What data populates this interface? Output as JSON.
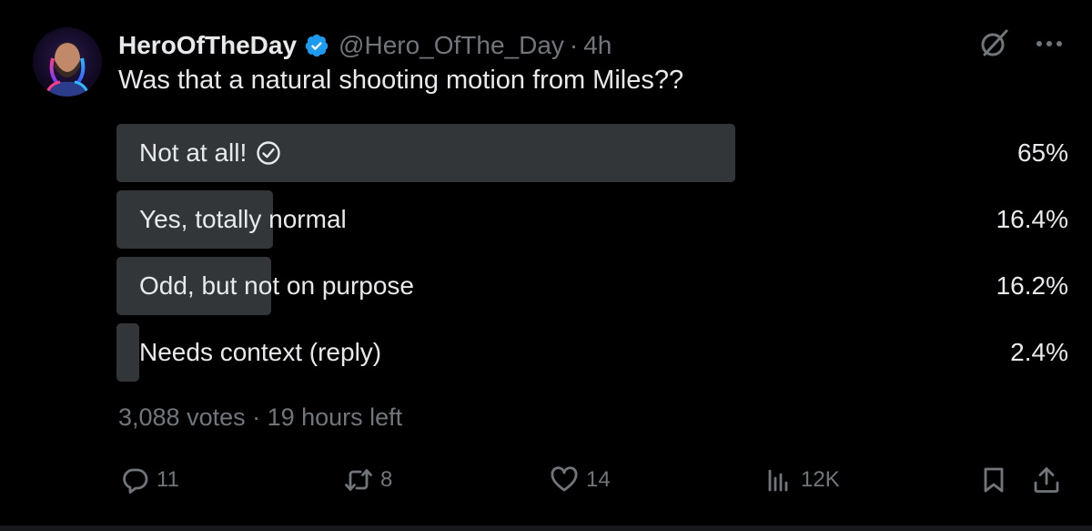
{
  "author": {
    "display_name": "HeroOfTheDay",
    "handle": "@Hero_OfThe_Day",
    "separator": "·",
    "time": "4h",
    "verified": true
  },
  "tweet": {
    "text": "Was that a natural shooting motion from Miles??"
  },
  "poll": {
    "options": [
      {
        "label": "Not at all!",
        "percent_text": "65%",
        "percent": 65,
        "winner": true
      },
      {
        "label": "Yes, totally normal",
        "percent_text": "16.4%",
        "percent": 16.4,
        "winner": false
      },
      {
        "label": "Odd, but not on purpose",
        "percent_text": "16.2%",
        "percent": 16.2,
        "winner": false
      },
      {
        "label": "Needs context (reply)",
        "percent_text": "2.4%",
        "percent": 2.4,
        "winner": false
      }
    ],
    "meta": "3,088 votes · 19 hours left"
  },
  "actions": {
    "replies": "11",
    "reposts": "8",
    "likes": "14",
    "views": "12K"
  },
  "icons": {
    "verified": "verified-badge-icon",
    "grok": "grok-icon",
    "more": "more-options-icon",
    "check": "check-circle-icon",
    "reply": "reply-icon",
    "repost": "repost-icon",
    "like": "heart-icon",
    "views": "analytics-icon",
    "bookmark": "bookmark-icon",
    "share": "share-icon"
  },
  "colors": {
    "background": "#000000",
    "primary_text": "#e7e9ea",
    "secondary_text": "#71767b",
    "poll_bar": "#333639",
    "verified": "#1d9bf0"
  }
}
